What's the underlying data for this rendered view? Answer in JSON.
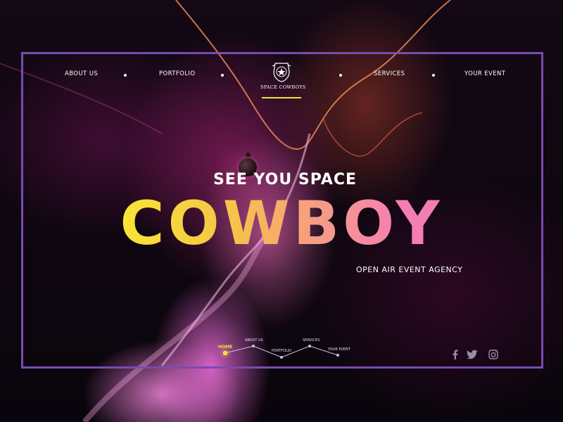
{
  "nav": {
    "items": [
      {
        "label": "ABOUT US"
      },
      {
        "label": "PORTFOLIO"
      },
      {
        "label": "SERVICES"
      },
      {
        "label": "YOUR EVENT"
      }
    ]
  },
  "logo": {
    "text": "SPACE COWBOYS"
  },
  "hero": {
    "subtitle": "SEE YOU SPACE",
    "title": "COWBOY",
    "tagline": "OPEN AIR EVENT AGENCY"
  },
  "timeline": {
    "items": [
      {
        "label": "HOME",
        "active": true
      },
      {
        "label": "ABOUT US",
        "active": false
      },
      {
        "label": "PORTFOLIO",
        "active": false
      },
      {
        "label": "SERVICES",
        "active": false
      },
      {
        "label": "YOUR EVENT",
        "active": false
      }
    ]
  },
  "social": {
    "icons": [
      "facebook-icon",
      "twitter-icon",
      "instagram-icon"
    ]
  },
  "colors": {
    "frame": "#7a4bb0",
    "accent_yellow": "#f4e23a",
    "gradient_start": "#f8f02e",
    "gradient_end": "#f27ab6"
  }
}
